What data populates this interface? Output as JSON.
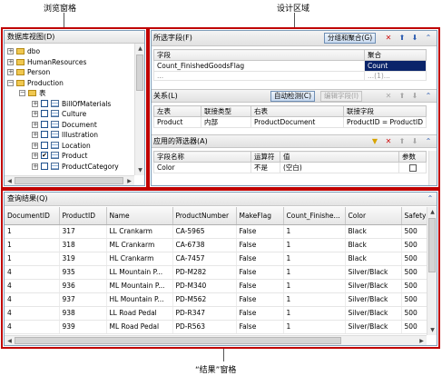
{
  "callouts": {
    "browse_pane": "浏览窗格",
    "design_area": "设计区域",
    "results_pane": "“结果”窗格"
  },
  "db_view": {
    "title": "数据库视图(D)",
    "tree": [
      {
        "label": "dbo",
        "expander": "+",
        "level": 0,
        "icon": "folder"
      },
      {
        "label": "HumanResources",
        "expander": "+",
        "level": 0,
        "icon": "folder"
      },
      {
        "label": "Person",
        "expander": "+",
        "level": 0,
        "icon": "folder"
      },
      {
        "label": "Production",
        "expander": "−",
        "level": 0,
        "icon": "folder"
      },
      {
        "label": "表",
        "expander": "−",
        "level": 1,
        "icon": "folder"
      },
      {
        "label": "BillOfMaterials",
        "expander": "+",
        "level": 2,
        "icon": "table",
        "checked": false
      },
      {
        "label": "Culture",
        "expander": "+",
        "level": 2,
        "icon": "table",
        "checked": false
      },
      {
        "label": "Document",
        "expander": "+",
        "level": 2,
        "icon": "table",
        "checked": false
      },
      {
        "label": "Illustration",
        "expander": "+",
        "level": 2,
        "icon": "table",
        "checked": false
      },
      {
        "label": "Location",
        "expander": "+",
        "level": 2,
        "icon": "table",
        "checked": false
      },
      {
        "label": "Product",
        "expander": "+",
        "level": 2,
        "icon": "table",
        "checked": true
      },
      {
        "label": "ProductCategory",
        "expander": "+",
        "level": 2,
        "icon": "table",
        "checked": false
      }
    ]
  },
  "selected_fields": {
    "title": "所选字段(F)",
    "group_button": "分组和聚合(G)",
    "columns": [
      "字段",
      "聚合"
    ],
    "rows": [
      {
        "field": "Count_FinishedGoodsFlag",
        "aggregate": "Count"
      }
    ],
    "partial_row": {
      "field": "...",
      "aggregate": "...(1)..."
    }
  },
  "relationships": {
    "title": "关系(L)",
    "auto_detect_button": "自动检测(C)",
    "edit_fields_button": "编辑字段(I)",
    "columns": [
      "左表",
      "联接类型",
      "右表",
      "联接字段"
    ],
    "rows": [
      {
        "left": "Product",
        "join": "内部",
        "right": "ProductDocument",
        "fields": "ProductID = ProductID"
      }
    ]
  },
  "filters": {
    "title": "应用的筛选器(A)",
    "columns": [
      "字段名称",
      "运算符",
      "值",
      "参数"
    ],
    "rows": [
      {
        "field": "Color",
        "operator": "不是",
        "value": "(空白)",
        "parameter": false
      }
    ]
  },
  "results": {
    "title": "查询结果(Q)",
    "columns": [
      "DocumentID",
      "ProductID",
      "Name",
      "ProductNumber",
      "MakeFlag",
      "Count_Finishe...",
      "Color",
      "SafetySto"
    ],
    "rows": [
      [
        "1",
        "317",
        "LL Crankarm",
        "CA-5965",
        "False",
        "1",
        "Black",
        "500"
      ],
      [
        "1",
        "318",
        "ML Crankarm",
        "CA-6738",
        "False",
        "1",
        "Black",
        "500"
      ],
      [
        "1",
        "319",
        "HL Crankarm",
        "CA-7457",
        "False",
        "1",
        "Black",
        "500"
      ],
      [
        "4",
        "935",
        "LL Mountain P...",
        "PD-M282",
        "False",
        "1",
        "Silver/Black",
        "500"
      ],
      [
        "4",
        "936",
        "ML Mountain P...",
        "PD-M340",
        "False",
        "1",
        "Silver/Black",
        "500"
      ],
      [
        "4",
        "937",
        "HL Mountain P...",
        "PD-M562",
        "False",
        "1",
        "Silver/Black",
        "500"
      ],
      [
        "4",
        "938",
        "LL Road Pedal",
        "PD-R347",
        "False",
        "1",
        "Silver/Black",
        "500"
      ],
      [
        "4",
        "939",
        "ML Road Pedal",
        "PD-R563",
        "False",
        "1",
        "Silver/Black",
        "500"
      ]
    ]
  },
  "icons": {
    "delete": "red-x-icon",
    "move_up": "up-arrow-icon",
    "move_down": "down-arrow-icon",
    "collapse": "collapse-chevron-icon",
    "filter": "filter-icon"
  },
  "colors": {
    "callout_frame": "#c00000",
    "selection": "#0a246a"
  }
}
